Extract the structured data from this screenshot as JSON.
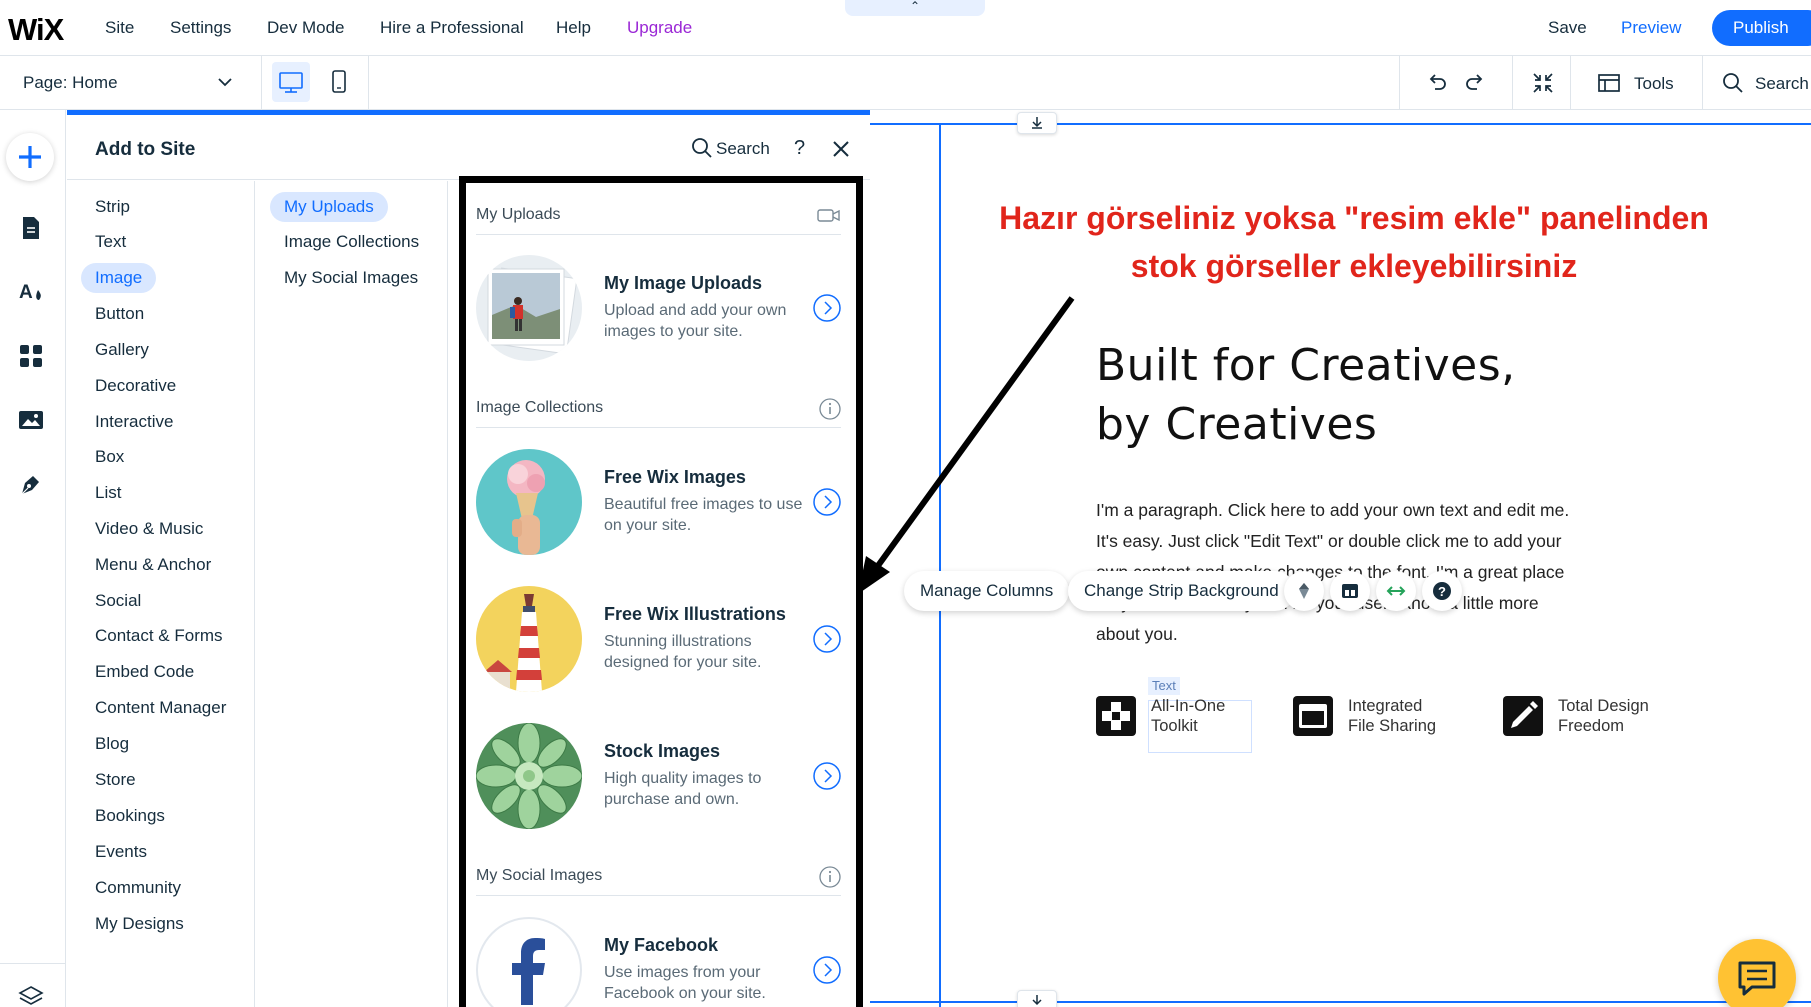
{
  "topbar": {
    "logo": "WiX",
    "menu": [
      "Site",
      "Settings",
      "Dev Mode",
      "Hire a Professional",
      "Help",
      "Upgrade"
    ],
    "upgrade_color": "#9a27d5",
    "collapse_glyph": "⌃",
    "save_label": "Save",
    "preview_label": "Preview",
    "publish_label": "Publish"
  },
  "secondbar": {
    "page_prefix": "Page:",
    "page_name": "Home",
    "tools_label": "Tools",
    "search_label": "Search"
  },
  "panel": {
    "title": "Add to Site",
    "search_label": "Search",
    "help_label": "?",
    "categories": [
      "Strip",
      "Text",
      "Image",
      "Button",
      "Gallery",
      "Decorative",
      "Interactive",
      "Box",
      "List",
      "Video & Music",
      "Menu & Anchor",
      "Social",
      "Contact & Forms",
      "Embed Code",
      "Content Manager",
      "Blog",
      "Store",
      "Bookings",
      "Events",
      "Community",
      "My Designs"
    ],
    "active_category": "Image",
    "subcategories": [
      "My Uploads",
      "Image Collections",
      "My Social Images"
    ],
    "active_subcategory": "My Uploads",
    "sections": {
      "uploads": "My Uploads",
      "collections": "Image Collections",
      "social": "My Social Images"
    },
    "cards": {
      "uploads": {
        "title": "My Image Uploads",
        "desc": "Upload and add your own images to your site."
      },
      "free_images": {
        "title": "Free Wix Images",
        "desc": "Beautiful free images to use on your site."
      },
      "illustrations": {
        "title": "Free Wix Illustrations",
        "desc": "Stunning illustrations designed for your site."
      },
      "stock": {
        "title": "Stock Images",
        "desc": "High quality images to purchase and own."
      },
      "facebook": {
        "title": "My Facebook",
        "desc": "Use images from your Facebook on your site."
      }
    }
  },
  "canvas": {
    "annotation_line1": "Hazır görseliniz yoksa \"resim ekle\" panelinden",
    "annotation_line2": "stok görseller ekleyebilirsiniz",
    "hero_line1": "Built for Creatives,",
    "hero_line2": "by Creatives",
    "paragraph": "I'm a paragraph. Click here to add your own text and edit me. It's easy. Just click \"Edit Text\" or double click me to add your own content and make changes to the font. I'm a great place for you to tell a story and let your users know a little more about you.",
    "manage_columns": "Manage Columns",
    "change_bg": "Change Strip Background",
    "text_tag": "Text",
    "features": [
      {
        "line1": "All-In-One",
        "line2": "Toolkit"
      },
      {
        "line1": "Integrated",
        "line2": "File Sharing"
      },
      {
        "line1": "Total Design",
        "line2": "Freedom"
      }
    ]
  },
  "colors": {
    "accent": "#116dff",
    "annotation": "#e1251b",
    "chat_button": "#ffc233"
  }
}
